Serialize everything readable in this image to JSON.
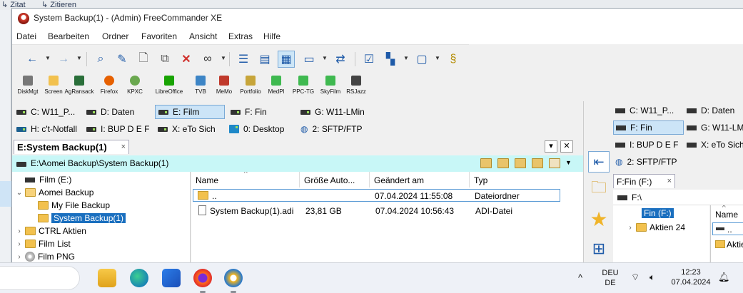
{
  "background_strip": {
    "item1": "Zitat",
    "item2": "Zitieren"
  },
  "window": {
    "title": "System Backup(1) - (Admin) FreeCommander XE"
  },
  "menu": [
    "Datei",
    "Bearbeiten",
    "Ordner",
    "Favoriten",
    "Ansicht",
    "Extras",
    "Hilfe"
  ],
  "toolbar_icons": [
    "back-arrow-icon",
    "forward-arrow-icon",
    "search-icon",
    "pencil-icon",
    "new-file-icon",
    "copy-icon",
    "delete-x-icon",
    "binoculars-icon",
    "tree-view-icon",
    "panel-view-icon",
    "details-view-icon",
    "preview-icon",
    "sync-icon",
    "checklist-icon",
    "grid-icon",
    "window-icon",
    "script-icon"
  ],
  "launchbar": [
    "DiskMgt",
    "Screen",
    "AgRansack",
    "Firefox",
    "KPXC",
    "LibreOffice",
    "TVB",
    "MeMo",
    "Portfolio",
    "MedPl",
    "PPC-TG",
    "SkyFilm",
    "RSJazz"
  ],
  "drives_left": {
    "row1": [
      "C: W11_P...",
      "D: Daten",
      "E: Film",
      "F: Fin",
      "G: W11-LMin"
    ],
    "row2": [
      "H: c't-Notfall",
      "I: BUP D E F",
      "X: eTo Sich",
      "0: Desktop",
      "2: SFTP/FTP"
    ],
    "selected": "E: Film"
  },
  "left_panel": {
    "tab": "E:System Backup(1)",
    "tab_close": "×",
    "path": "E:\\Aomei Backup\\System Backup(1)",
    "pane_menu": "▾",
    "pane_close": "✕",
    "tree": [
      {
        "label": "Film (E:)",
        "type": "drive",
        "expander": ""
      },
      {
        "label": "Aomei Backup",
        "type": "folder",
        "expander": "⌄"
      },
      {
        "label": "My File Backup",
        "type": "folder",
        "expander": ""
      },
      {
        "label": "System Backup(1)",
        "type": "folder",
        "expander": "",
        "selected": true
      },
      {
        "label": "CTRL Aktien",
        "type": "folder",
        "expander": "›"
      },
      {
        "label": "Film List",
        "type": "folder",
        "expander": "›"
      },
      {
        "label": "Film PNG",
        "type": "disk",
        "expander": "›"
      }
    ],
    "columns": [
      "Name",
      "Größe Auto...",
      "Geändert am",
      "Typ"
    ],
    "sort_indicator": "^",
    "files": [
      {
        "name": "..",
        "size": "",
        "modified": "07.04.2024 11:55:08",
        "type": "Dateiordner"
      },
      {
        "name": "System Backup(1).adi",
        "size": "23,81 GB",
        "modified": "07.04.2024 10:56:43",
        "type": "ADI-Datei"
      }
    ]
  },
  "middle_strip_icons": [
    "compare-panels-icon",
    "folder-add-icon",
    "favorites-star-icon",
    "copy-list-icon"
  ],
  "drives_right": [
    "C: W11_P...",
    "D: Daten",
    "F: Fin",
    "G: W11-LM",
    "I: BUP D E F",
    "X: eTo Sich",
    "2: SFTP/FTP"
  ],
  "right_panel": {
    "tab": "F:Fin (F:)",
    "tab_close": "×",
    "path": "F:\\",
    "tree": [
      {
        "label": "Fin (F:)",
        "selected": true
      },
      {
        "label": "Aktien 24",
        "expander": "›"
      }
    ],
    "column": "Name",
    "sort_indicator": "^",
    "files": [
      "..",
      "Aktien"
    ]
  },
  "taskbar": {
    "apps": [
      "file-explorer-icon",
      "edge-icon",
      "store-icon",
      "firefox-icon",
      "freecommander-icon"
    ],
    "chevron": "^",
    "lang_line1": "DEU",
    "lang_line2": "DE",
    "time": "12:23",
    "date": "07.04.2024"
  },
  "colors": {
    "selection": "#1a6fbf",
    "path_bar": "#c8f7f7",
    "active_button": "#cde6f7"
  }
}
